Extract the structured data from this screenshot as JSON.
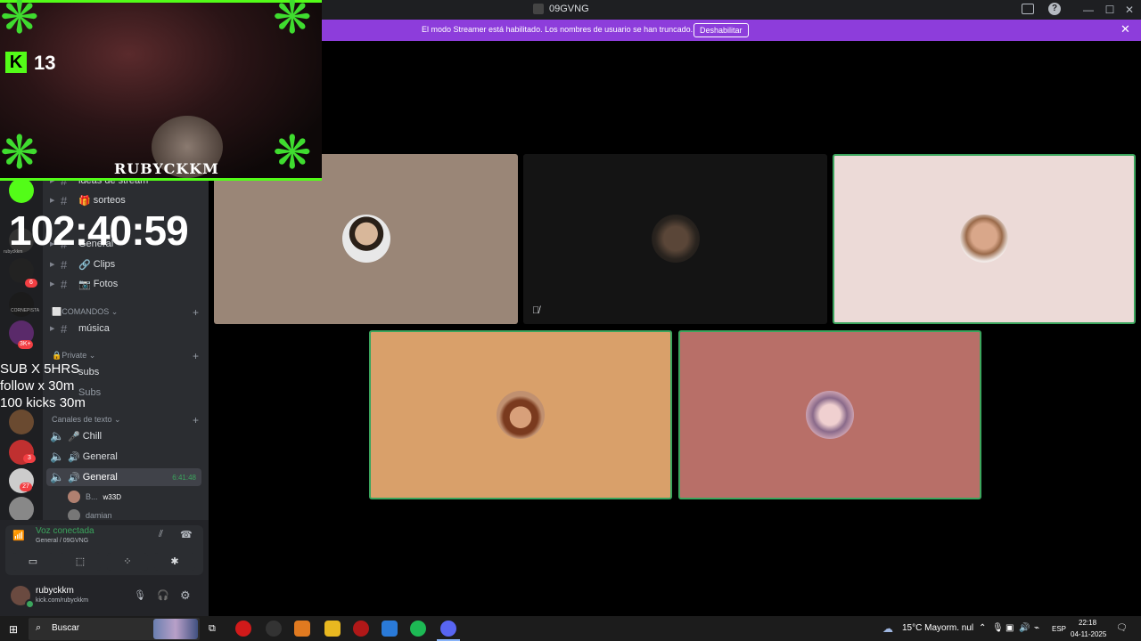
{
  "window": {
    "title": "09GVNG",
    "controls": [
      "—",
      "☐",
      "✕"
    ]
  },
  "banner": {
    "message": "El modo Streamer está habilitado. Los nombres de usuario se han truncado.",
    "button": "Deshabilitar",
    "close": "✕"
  },
  "overlay": {
    "kick_count": "13",
    "watermark": "RUBYCKKM",
    "timer": "102:40:59",
    "goals": [
      "SUB X 5HRS",
      "follow x 30m",
      "100 kicks 30m"
    ]
  },
  "rail": {
    "server_labels": [
      "rubyckkm",
      "CORNEPISTA"
    ],
    "badges": [
      "6",
      "3K+",
      "3",
      "27"
    ]
  },
  "channels": {
    "top_truncated": "ideas de stream",
    "items_top": [
      {
        "label": "sorteos",
        "emoji": "🎁"
      },
      {
        "label": "General",
        "emoji": ""
      },
      {
        "label": "Clips",
        "emoji": "🔗"
      },
      {
        "label": "Fotos",
        "emoji": "📷"
      }
    ],
    "cat_comandos": "COMANDOS",
    "cat_comandos_icon": "⬜",
    "musica": "música",
    "cat_private": "Private",
    "subs1": "subs",
    "subs2": "Subs",
    "cat_text": "Canales de texto",
    "voice": [
      {
        "label": "Chill"
      },
      {
        "label": "General"
      },
      {
        "label": "General",
        "time": "6:41:48"
      }
    ],
    "members": [
      {
        "name": "B...",
        "tag": "w33D"
      },
      {
        "name": "damian"
      }
    ]
  },
  "voice_panel": {
    "status": "Voz conectada",
    "channel": "General / 09GVNG"
  },
  "user": {
    "name": "rubyckkm",
    "status": "kick.com/rubyckkm"
  },
  "tiles": [
    {
      "color": "#9a8677",
      "speaking": false,
      "muted": false
    },
    {
      "color": "#141414",
      "speaking": false,
      "muted": true
    },
    {
      "color": "#ecdad7",
      "speaking": true,
      "muted": false
    },
    {
      "color": "#d9a06a",
      "speaking": true,
      "muted": false
    },
    {
      "color": "#b86f68",
      "speaking": true,
      "muted": false
    }
  ],
  "taskbar": {
    "search": "Buscar",
    "weather": "15°C  Mayorm. nul",
    "lang": "ESP",
    "time": "22:18",
    "date": "04-11-2025"
  },
  "colors": {
    "accent_purple": "#8d3ddb",
    "speaking_green": "#3ba55d",
    "kick_green": "#53fc18"
  }
}
